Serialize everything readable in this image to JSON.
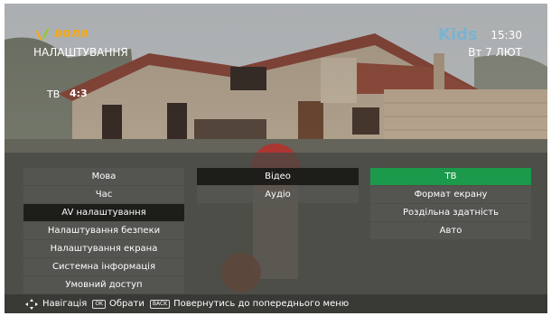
{
  "brand": {
    "logo_text": "воля",
    "channel_logo_text": "Kids"
  },
  "header": {
    "section_title": "НАЛАШТУВАННЯ",
    "time": "15:30",
    "date": "Вт 7 ЛЮТ"
  },
  "preview": {
    "tv_label": "ТВ",
    "aspect_ratio": "4:3"
  },
  "menu": {
    "col1": [
      "Мова",
      "Час",
      "AV налаштування",
      "Налаштування безпеки",
      "Налаштування екрана",
      "Системна інформація",
      "Умовний доступ"
    ],
    "col2": [
      "Відео",
      "Аудіо"
    ],
    "col3": [
      "ТВ",
      "Формат екрану",
      "Роздільна здатність",
      "Авто"
    ]
  },
  "footer": {
    "nav_label": "Навігація",
    "ok_key": "OK",
    "select_label": "Обрати",
    "back_key": "BACK",
    "back_label": "Повернутись до попереднього меню"
  },
  "colors": {
    "accent": "#1a9a4a",
    "logo": "#f4a81a",
    "selected_dark": "#191916"
  }
}
